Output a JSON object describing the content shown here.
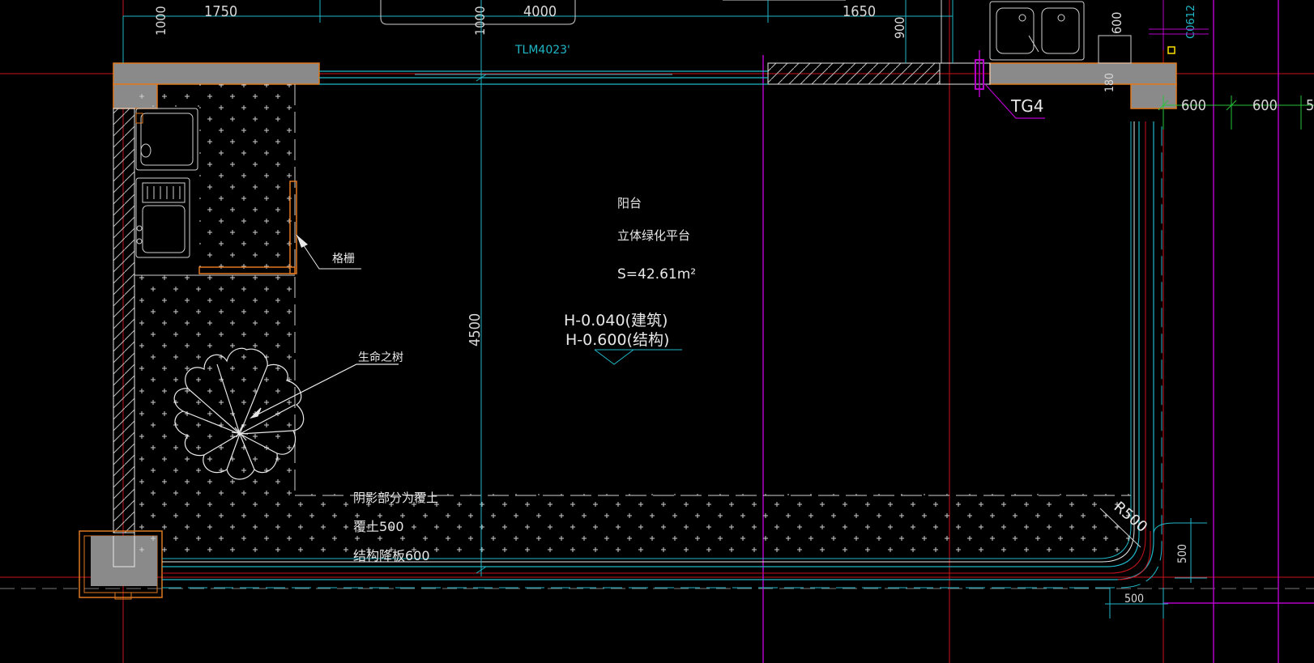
{
  "colors": {
    "background": "#000000",
    "cyan": "#1fb7c7",
    "white": "#e8e8e8",
    "red": "#c8141e",
    "magenta": "#b400c8",
    "orange": "#e07820",
    "wall_fill": "#8a8a8a",
    "green": "#27c23a",
    "yellow": "#ffe000"
  },
  "top_dims": {
    "d1000_a": "1000",
    "d1750": "1750",
    "d1000_b": "1000",
    "d4000": "4000",
    "d1650": "1650",
    "d900": "900",
    "d600": "600"
  },
  "door_tag": "TLM4023'",
  "window_tag": "C0612",
  "drain_tag": "TG4",
  "right_dims": {
    "d600_a": "600",
    "d600_b": "600",
    "d180": "180",
    "d5": "5"
  },
  "room": {
    "name": "阳台",
    "subtitle": "立体绿化平台",
    "area": "S=42.61m²",
    "level_arch": "H-0.040(建筑)",
    "level_struct": "H-0.600(结构)"
  },
  "annotations": {
    "lattice": "格栅",
    "tree": "生命之树",
    "shade_note_1": "阴影部分为覆土",
    "shade_note_2": "覆土500",
    "shade_note_3": "结构降板600"
  },
  "interior_dims": {
    "d4500": "4500",
    "radius": "R500",
    "corner_500_h": "500",
    "corner_500_v": "500"
  }
}
